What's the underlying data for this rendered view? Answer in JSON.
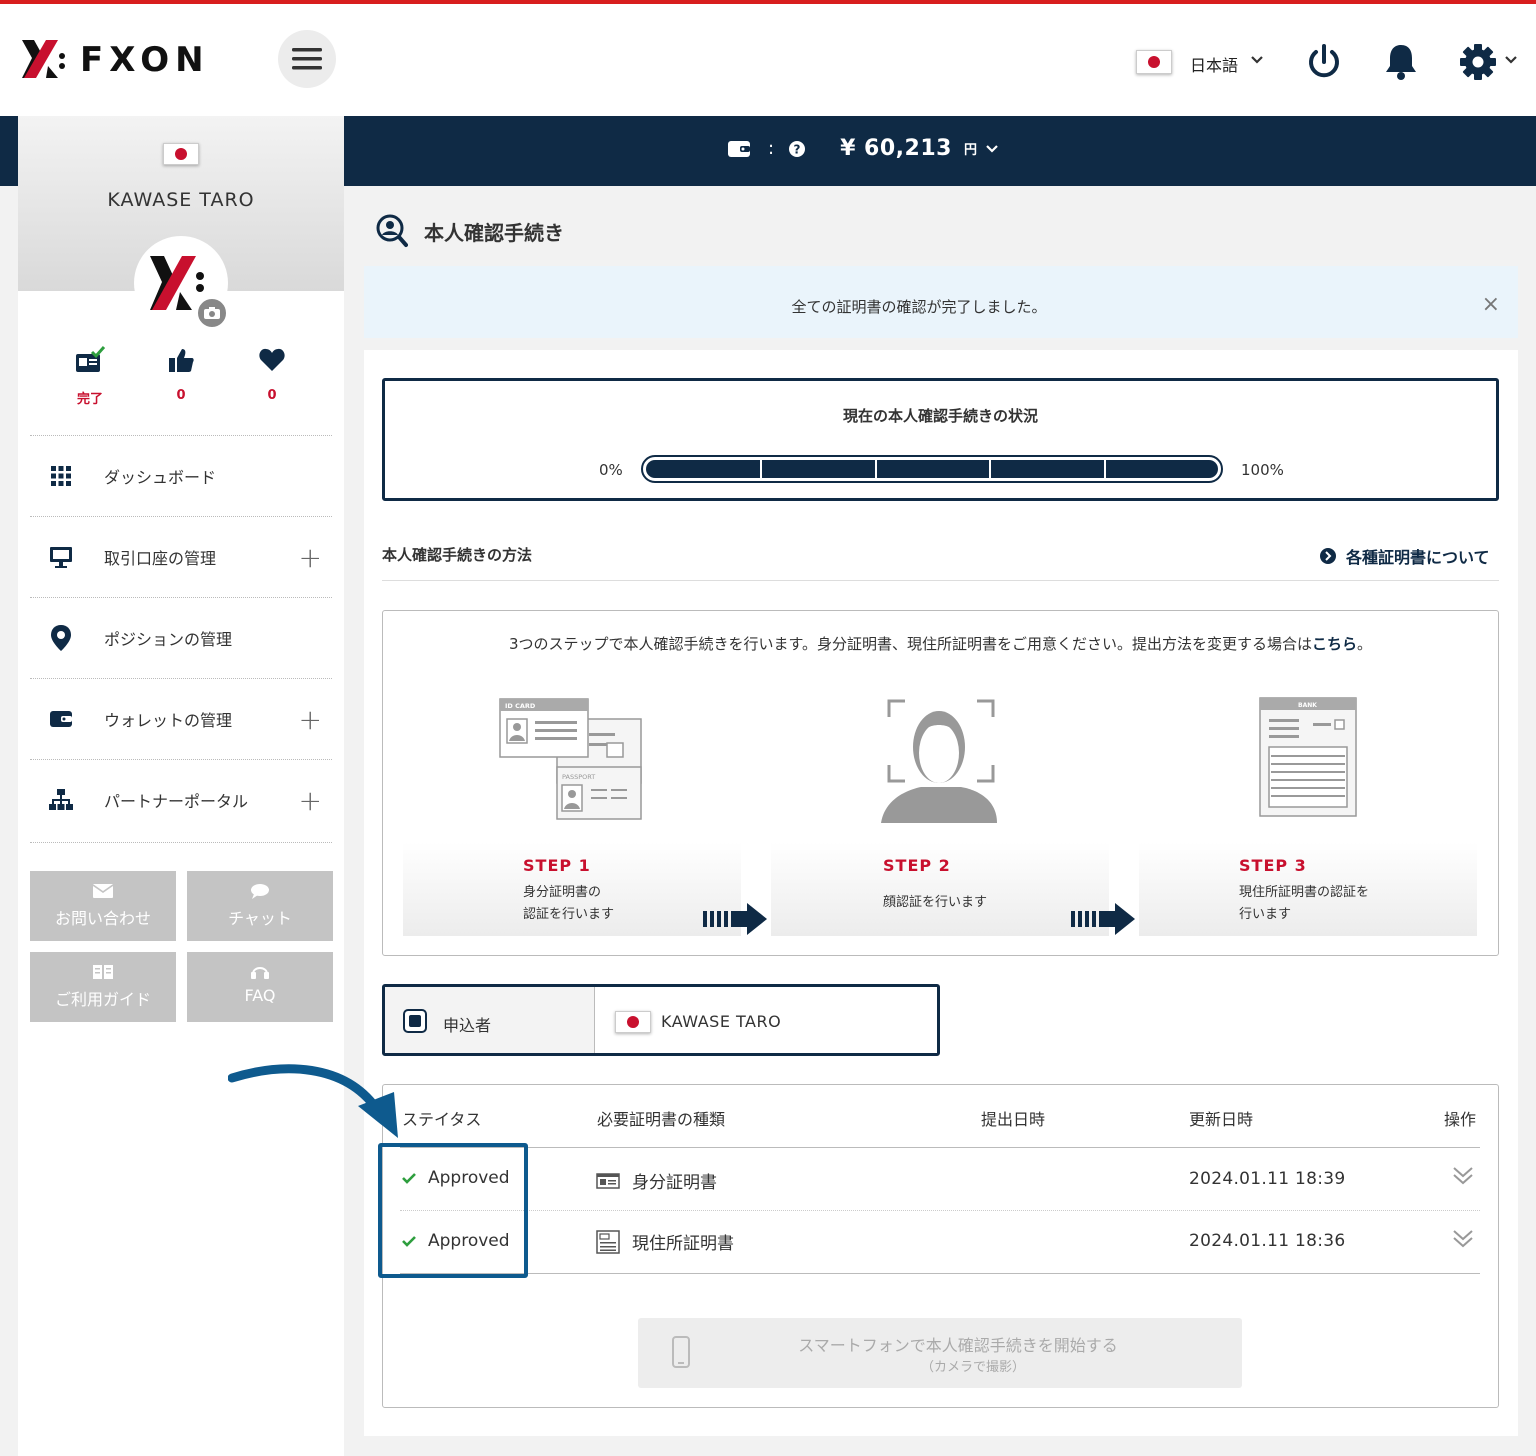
{
  "header": {
    "brand": "FXON",
    "language": "日本語",
    "icons": [
      "menu-icon",
      "power-icon",
      "bell-icon",
      "gear-icon"
    ]
  },
  "banner": {
    "separator": ":",
    "balance": "¥ 60,213",
    "unit": "円"
  },
  "sidebar": {
    "user_name": "KAWASE TARO",
    "stats": [
      {
        "icon": "id-card-check-icon",
        "value": "完了"
      },
      {
        "icon": "thumbs-up-icon",
        "value": "0"
      },
      {
        "icon": "heart-icon",
        "value": "0"
      }
    ],
    "menu": [
      {
        "label": "ダッシュボード",
        "icon": "grid-icon",
        "expandable": false
      },
      {
        "label": "取引口座の管理",
        "icon": "monitor-icon",
        "expandable": true
      },
      {
        "label": "ポジションの管理",
        "icon": "map-pin-icon",
        "expandable": false
      },
      {
        "label": "ウォレットの管理",
        "icon": "wallet-icon",
        "expandable": true
      },
      {
        "label": "パートナーポータル",
        "icon": "sitemap-icon",
        "expandable": true
      }
    ],
    "buttons": [
      {
        "label": "お問い合わせ",
        "icon": "envelope-icon"
      },
      {
        "label": "チャット",
        "icon": "chat-bubble-icon"
      },
      {
        "label": "ご利用ガイド",
        "icon": "guide-book-icon"
      },
      {
        "label": "FAQ",
        "icon": "headset-icon"
      }
    ]
  },
  "main": {
    "page_title": "本人確認手続き",
    "alert": {
      "text": "全ての証明書の確認が完了しました。",
      "close": "×"
    },
    "status": {
      "title": "現在の本人確認手続きの状況",
      "min_label": "0%",
      "max_label": "100%",
      "progress": 1.0
    },
    "method": {
      "title": "本人確認手続きの方法",
      "link": "各種証明書について"
    },
    "steps": {
      "desc_before": "3つのステップで本人確認手続きを行います。身分証明書、現住所証明書をご用意ください。提出方法を変更する場合は",
      "desc_link": "こちら",
      "desc_after": "。",
      "illustration_labels": {
        "id_card": "ID CARD",
        "passport": "PASSPORT",
        "bank": "BANK"
      },
      "items": [
        {
          "label": "STEP 1",
          "line1": "身分証明書の",
          "line2": "認証を行います"
        },
        {
          "label": "STEP 2",
          "line1": "顔認証を行います",
          "line2": ""
        },
        {
          "label": "STEP 3",
          "line1": "現住所証明書の認証を",
          "line2": "行います"
        }
      ]
    },
    "applicant": {
      "label": "申込者",
      "name": "KAWASE TARO"
    },
    "table": {
      "headers": [
        "ステイタス",
        "必要証明書の種類",
        "提出日時",
        "更新日時",
        "操作"
      ],
      "rows": [
        {
          "status": "Approved",
          "type": "身分証明書",
          "type_icon": "id-card-icon",
          "submitted": "",
          "updated": "2024.01.11 18:39"
        },
        {
          "status": "Approved",
          "type": "現住所証明書",
          "type_icon": "address-doc-icon",
          "submitted": "",
          "updated": "2024.01.11 18:36"
        }
      ]
    },
    "smartphone_button": {
      "label": "スマートフォンで本人確認手続きを開始する",
      "sublabel": "（カメラで撮影）"
    }
  },
  "colors": {
    "navy": "#0f2a45",
    "brand_red": "#c8102e",
    "approved_green": "#2e9e3e",
    "highlight_blue": "#0e5a8e"
  }
}
